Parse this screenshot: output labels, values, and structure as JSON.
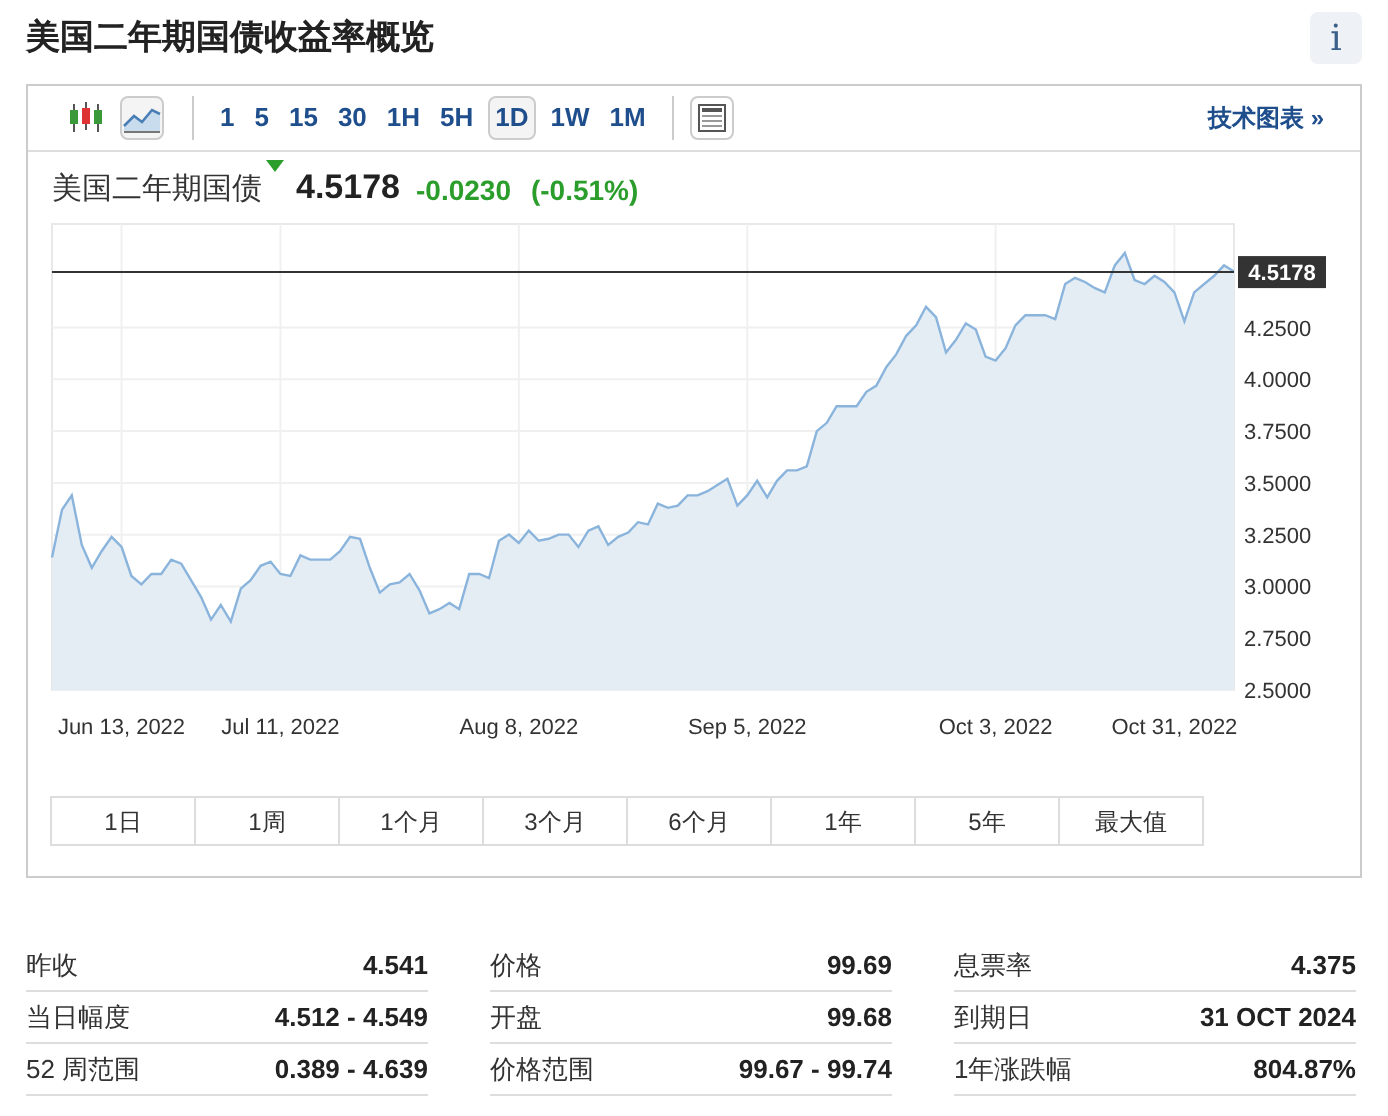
{
  "title": "美国二年期国债收益率概览",
  "info_button": "i",
  "toolbar": {
    "chart_types": [
      {
        "kind": "candlestick",
        "selected": false
      },
      {
        "kind": "line",
        "selected": true
      }
    ],
    "intervals": [
      {
        "label": "1",
        "selected": false
      },
      {
        "label": "5",
        "selected": false
      },
      {
        "label": "15",
        "selected": false
      },
      {
        "label": "30",
        "selected": false
      },
      {
        "label": "1H",
        "selected": false
      },
      {
        "label": "5H",
        "selected": false
      },
      {
        "label": "1D",
        "selected": true
      },
      {
        "label": "1W",
        "selected": false
      },
      {
        "label": "1M",
        "selected": false
      }
    ],
    "technical_link": "技术图表 »"
  },
  "quote": {
    "name": "美国二年期国债",
    "down": true,
    "price": "4.5178",
    "change": "-0.0230",
    "change_percent": "(-0.51%)"
  },
  "chart_data": {
    "type": "area",
    "grid": true,
    "categories": [
      null,
      null,
      null,
      null,
      null,
      null,
      null,
      "Jun 13, 2022",
      null,
      null,
      null,
      null,
      null,
      null,
      null,
      null,
      null,
      null,
      null,
      null,
      null,
      null,
      null,
      "Jul 11, 2022",
      null,
      null,
      null,
      null,
      null,
      null,
      null,
      null,
      null,
      null,
      null,
      null,
      null,
      null,
      null,
      null,
      null,
      null,
      null,
      null,
      null,
      null,
      null,
      "Aug 8, 2022",
      null,
      null,
      null,
      null,
      null,
      null,
      null,
      null,
      null,
      null,
      null,
      null,
      null,
      null,
      null,
      null,
      null,
      null,
      null,
      null,
      null,
      null,
      "Sep 5, 2022",
      null,
      null,
      null,
      null,
      null,
      null,
      null,
      null,
      null,
      null,
      null,
      null,
      null,
      null,
      null,
      null,
      null,
      null,
      null,
      null,
      null,
      null,
      null,
      null,
      "Oct 3, 2022",
      null,
      null,
      null,
      null,
      null,
      null,
      null,
      null,
      null,
      null,
      null,
      null,
      null,
      null,
      null,
      null,
      null,
      "Oct 31, 2022",
      null,
      null,
      null,
      null,
      null,
      null
    ],
    "series": [
      {
        "color": "#8ab4dc",
        "values": [
          3.14,
          3.37,
          3.44,
          3.2,
          3.09,
          3.17,
          3.24,
          3.19,
          3.05,
          3.01,
          3.06,
          3.06,
          3.13,
          3.11,
          3.03,
          2.95,
          2.84,
          2.91,
          2.83,
          2.99,
          3.03,
          3.1,
          3.12,
          3.06,
          3.05,
          3.15,
          3.13,
          3.13,
          3.13,
          3.17,
          3.24,
          3.23,
          3.09,
          2.97,
          3.01,
          3.02,
          3.06,
          2.98,
          2.87,
          2.89,
          2.92,
          2.89,
          3.06,
          3.06,
          3.04,
          3.22,
          3.25,
          3.21,
          3.27,
          3.22,
          3.23,
          3.25,
          3.25,
          3.19,
          3.27,
          3.29,
          3.2,
          3.24,
          3.26,
          3.31,
          3.3,
          3.4,
          3.38,
          3.39,
          3.44,
          3.44,
          3.46,
          3.49,
          3.52,
          3.39,
          3.44,
          3.51,
          3.43,
          3.51,
          3.56,
          3.56,
          3.58,
          3.75,
          3.79,
          3.87,
          3.87,
          3.87,
          3.94,
          3.97,
          4.06,
          4.12,
          4.21,
          4.26,
          4.35,
          4.3,
          4.13,
          4.19,
          4.27,
          4.24,
          4.11,
          4.09,
          4.15,
          4.26,
          4.31,
          4.31,
          4.31,
          4.29,
          4.46,
          4.49,
          4.47,
          4.44,
          4.42,
          4.55,
          4.61,
          4.48,
          4.46,
          4.5,
          4.47,
          4.42,
          4.28,
          4.42,
          4.46,
          4.5,
          4.55,
          4.52
        ]
      }
    ],
    "yticks": [
      {
        "value": 2.5,
        "label": "2.5000"
      },
      {
        "value": 2.75,
        "label": "2.7500"
      },
      {
        "value": 3,
        "label": "3.0000"
      },
      {
        "value": 3.25,
        "label": "3.2500"
      },
      {
        "value": 3.5,
        "label": "3.5000"
      },
      {
        "value": 3.75,
        "label": "3.7500"
      },
      {
        "value": 4,
        "label": "4.0000"
      },
      {
        "value": 4.25,
        "label": "4.2500"
      }
    ],
    "ylim": [
      2.5,
      4.75
    ],
    "ref_lines": [
      {
        "axis": "y",
        "value": 4.5178,
        "label": "4.5178"
      }
    ]
  },
  "ranges": [
    {
      "label": "1日"
    },
    {
      "label": "1周"
    },
    {
      "label": "1个月"
    },
    {
      "label": "3个月"
    },
    {
      "label": "6个月"
    },
    {
      "label": "1年"
    },
    {
      "label": "5年"
    },
    {
      "label": "最大值"
    }
  ],
  "stats": [
    [
      {
        "label": "昨收",
        "value": "4.541"
      },
      {
        "label": "当日幅度",
        "value": "4.512 - 4.549"
      },
      {
        "label": "52 周范围",
        "value": "0.389 - 4.639"
      }
    ],
    [
      {
        "label": "价格",
        "value": "99.69"
      },
      {
        "label": "开盘",
        "value": "99.68"
      },
      {
        "label": "价格范围",
        "value": "99.67 - 99.74"
      }
    ],
    [
      {
        "label": "息票率",
        "value": "4.375"
      },
      {
        "label": "到期日",
        "value": "31 OCT 2024"
      },
      {
        "label": "1年涨跌幅",
        "value": "804.87%"
      }
    ]
  ]
}
